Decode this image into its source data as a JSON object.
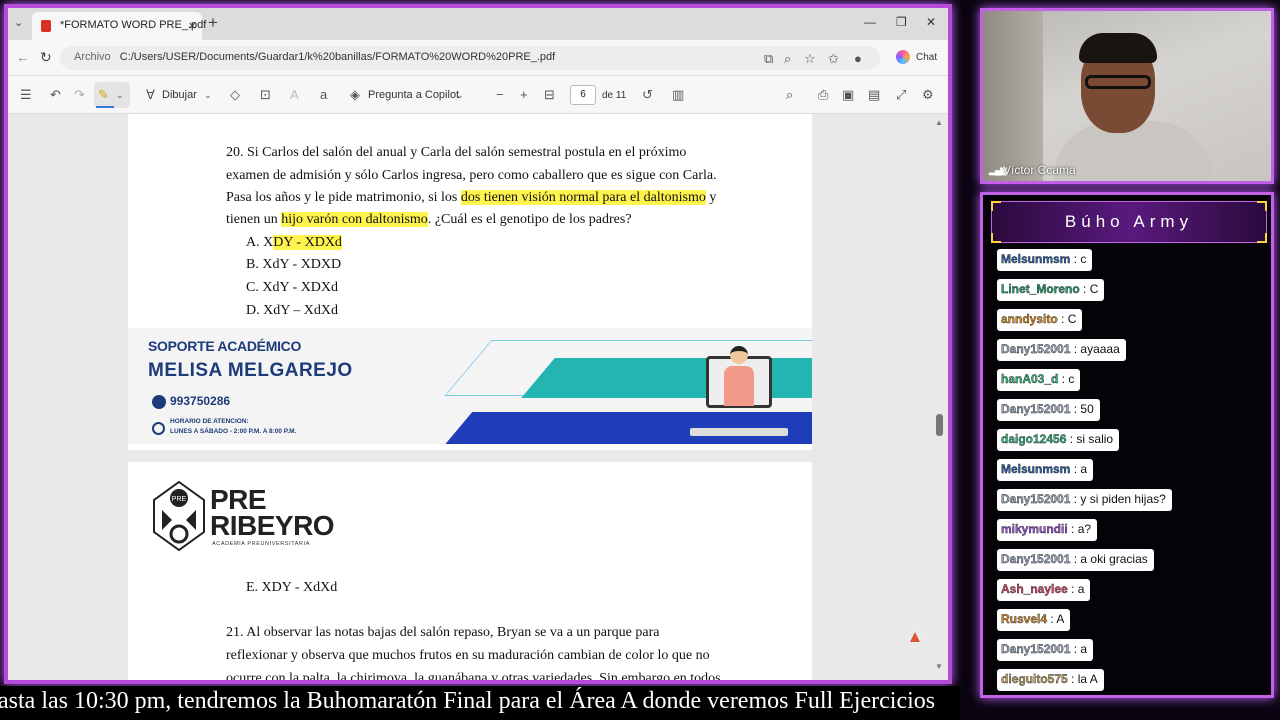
{
  "browser": {
    "tab_title": "*FORMATO WORD PRE_.pdf",
    "url_scheme": "Archivo",
    "url": "C:/Users/USER/Documents/Guardar1/k%20banillas/FORMATO%20WORD%20PRE_.pdf",
    "chat_label": "Chat"
  },
  "pdf_toolbar": {
    "draw_label": "Dibujar",
    "copilot_label": "Pregunta a Copilot",
    "page_current": "6",
    "page_total": "de 11"
  },
  "question20": {
    "line1": "20.   Si Carlos del salón del anual y Carla del salón semestral postula en el próximo",
    "line2": "examen de admisión y sólo Carlos ingresa, pero como caballero que es sigue con Carla.",
    "line3_pre": "Pasa los años y le pide matrimonio, si los ",
    "line3_mark": "dos tienen visión normal para el daltonismo",
    "line3_post": " y",
    "line4_pre": "tienen un ",
    "line4_mark": "hijo varón con daltonismo",
    "line4_post": ". ¿Cuál es el genotipo de los padres?",
    "opt_a_pre": "A.   X",
    "opt_a_mark": "DY - XDXd",
    "opt_b": "B.   XdY - XDXD",
    "opt_c": "C.   XdY - XDXd",
    "opt_d": "D.   XdY – XdXd",
    "opt_e": "E.   XDY - XdXd"
  },
  "banner": {
    "title_small": "SOPORTE ACADÉMICO",
    "name": "MELISA MELGAREJO",
    "phone": "993750286",
    "hours_label": "HORARIO DE ATENCION:",
    "hours": "LUNES A SÁBADO - 2:00 P.M. A 8:00 P.M."
  },
  "logo": {
    "line1": "PRE",
    "line2": "RIBEYRO",
    "sub": "ACADEMIA PREUNIVERSITARIA",
    "shield": "PRE"
  },
  "question21": {
    "line1": "21.      Al observar las notas bajas del salón repaso, Bryan se va a un parque para",
    "line2": "reflexionar y observa que muchos frutos en su maduración cambian de color lo que no",
    "line3": "ocurre con la palta, la chirimoya, la guanábana y otras variedades. Sin embargo en todos"
  },
  "webcam": {
    "name": "Víctor Ccama"
  },
  "chat": {
    "title": "Búho Army",
    "messages": [
      {
        "user": "Melsunmsm",
        "text": "c",
        "color": "#2a5ea8"
      },
      {
        "user": "Linet_Moreno",
        "text": "C",
        "color": "#22a06b"
      },
      {
        "user": "anndysito",
        "text": "C",
        "color": "#e08a1e"
      },
      {
        "user": "Dany152001",
        "text": "ayaaaa",
        "color": "#9aa8bc"
      },
      {
        "user": "hanA03_d",
        "text": "c",
        "color": "#2fb57a"
      },
      {
        "user": "Dany152001",
        "text": "50",
        "color": "#9aa8bc"
      },
      {
        "user": "daigo12456",
        "text": "si salio",
        "color": "#2fb57a"
      },
      {
        "user": "Melsunmsm",
        "text": "a",
        "color": "#2a5ea8"
      },
      {
        "user": "Dany152001",
        "text": "y si piden hijas?",
        "color": "#9aa8bc"
      },
      {
        "user": "mikymundii",
        "text": "a?",
        "color": "#9b52d8"
      },
      {
        "user": "Dany152001",
        "text": "a oki gracias",
        "color": "#9aa8bc"
      },
      {
        "user": "Ash_naylee",
        "text": "a",
        "color": "#d84a6a"
      },
      {
        "user": "Rusvel4",
        "text": "A",
        "color": "#d28a2a"
      },
      {
        "user": "Dany152001",
        "text": "a",
        "color": "#9aa8bc"
      },
      {
        "user": "dieguito575",
        "text": "la A",
        "color": "#c0a060"
      }
    ]
  },
  "ticker": {
    "text": "asta las 10:30 pm, tendremos la Buhomaratón Final para el Área A donde veremos Full Ejercicios"
  }
}
